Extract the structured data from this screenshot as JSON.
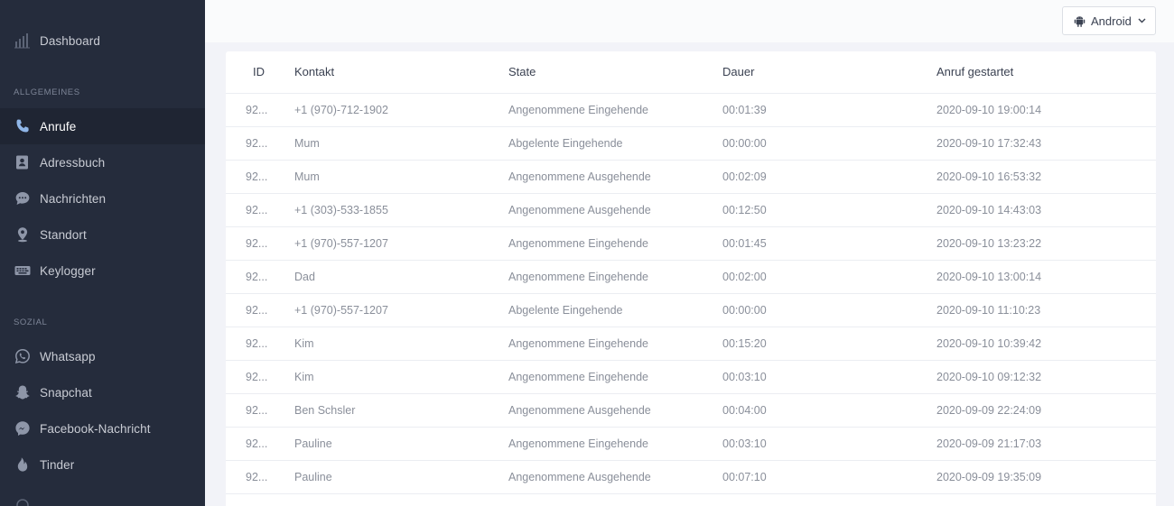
{
  "sidebar": {
    "dashboard": {
      "label": "Dashboard",
      "icon": "bar-chart-icon"
    },
    "section_general": "ALLGEMEINES",
    "general_items": [
      {
        "label": "Anrufe",
        "icon": "phone-icon",
        "active": true
      },
      {
        "label": "Adressbuch",
        "icon": "address-book-icon"
      },
      {
        "label": "Nachrichten",
        "icon": "chat-icon"
      },
      {
        "label": "Standort",
        "icon": "location-pin-icon"
      },
      {
        "label": "Keylogger",
        "icon": "keyboard-icon"
      }
    ],
    "section_social": "SOZIAL",
    "social_items": [
      {
        "label": "Whatsapp",
        "icon": "whatsapp-icon"
      },
      {
        "label": "Snapchat",
        "icon": "snapchat-icon"
      },
      {
        "label": "Facebook-Nachricht",
        "icon": "messenger-icon"
      },
      {
        "label": "Tinder",
        "icon": "flame-icon"
      }
    ]
  },
  "header": {
    "device": {
      "label": "Android",
      "icon": "android-icon"
    }
  },
  "table": {
    "columns": [
      "ID",
      "Kontakt",
      "State",
      "Dauer",
      "Anruf gestartet"
    ],
    "rows": [
      {
        "id": "92...",
        "contact": "+1 (970)-712-1902",
        "state": "Angenommene Eingehende",
        "duration": "00:01:39",
        "started": "2020-09-10 19:00:14"
      },
      {
        "id": "92...",
        "contact": "Mum",
        "state": "Abgelente Eingehende",
        "duration": "00:00:00",
        "started": "2020-09-10 17:32:43"
      },
      {
        "id": "92...",
        "contact": "Mum",
        "state": "Angenommene Ausgehende",
        "duration": "00:02:09",
        "started": "2020-09-10 16:53:32"
      },
      {
        "id": "92...",
        "contact": "+1 (303)-533-1855",
        "state": "Angenommene Ausgehende",
        "duration": "00:12:50",
        "started": "2020-09-10 14:43:03"
      },
      {
        "id": "92...",
        "contact": "+1 (970)-557-1207",
        "state": "Angenommene Eingehende",
        "duration": "00:01:45",
        "started": "2020-09-10 13:23:22"
      },
      {
        "id": "92...",
        "contact": "Dad",
        "state": "Angenommene Eingehende",
        "duration": "00:02:00",
        "started": "2020-09-10 13:00:14"
      },
      {
        "id": "92...",
        "contact": "+1 (970)-557-1207",
        "state": "Abgelente Eingehende",
        "duration": "00:00:00",
        "started": "2020-09-10 11:10:23"
      },
      {
        "id": "92...",
        "contact": "Kim",
        "state": "Angenommene Eingehende",
        "duration": "00:15:20",
        "started": "2020-09-10 10:39:42"
      },
      {
        "id": "92...",
        "contact": "Kim",
        "state": "Angenommene Eingehende",
        "duration": "00:03:10",
        "started": "2020-09-10 09:12:32"
      },
      {
        "id": "92...",
        "contact": "Ben Schsler",
        "state": "Angenommene Ausgehende",
        "duration": "00:04:00",
        "started": "2020-09-09 22:24:09"
      },
      {
        "id": "92...",
        "contact": "Pauline",
        "state": "Angenommene Eingehende",
        "duration": "00:03:10",
        "started": "2020-09-09 21:17:03"
      },
      {
        "id": "92...",
        "contact": "Pauline",
        "state": "Angenommene Ausgehende",
        "duration": "00:07:10",
        "started": "2020-09-09 19:35:09"
      }
    ]
  },
  "colors": {
    "sidebar_bg": "#252c3c",
    "sidebar_active_bg": "#1f2533",
    "page_bg": "#f2f3f8",
    "text_muted": "#8a8f9a"
  }
}
